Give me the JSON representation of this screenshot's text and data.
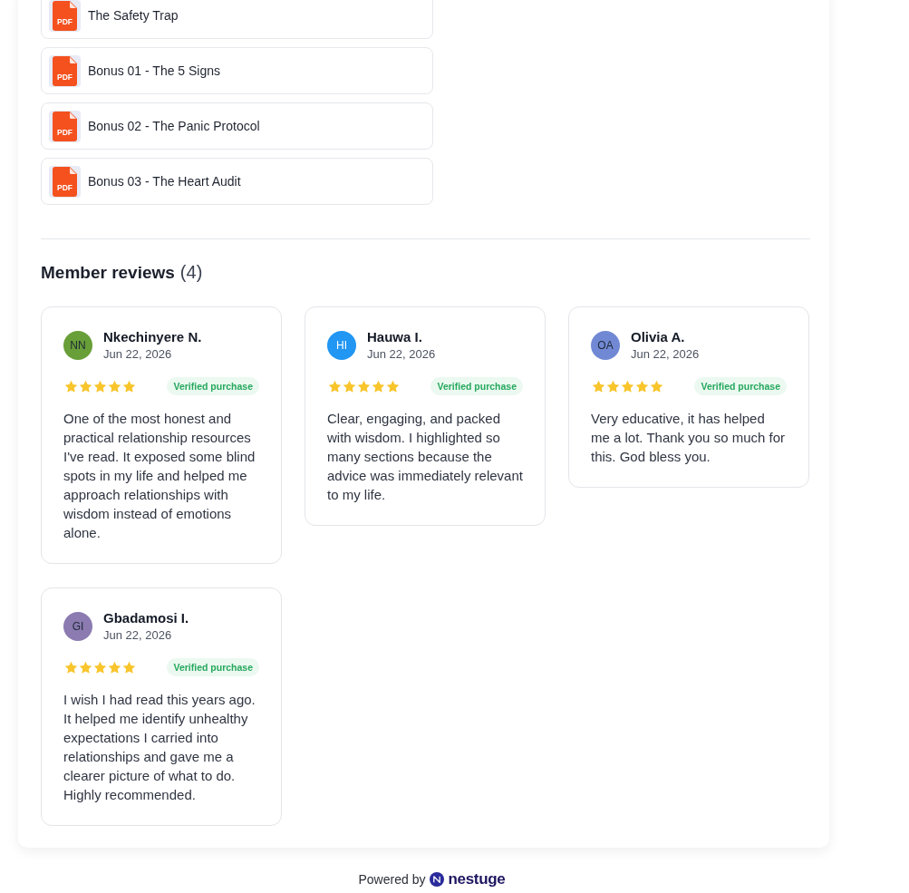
{
  "files": [
    {
      "title": "The Safety Trap",
      "file_type": "PDF"
    },
    {
      "title": "Bonus 01 - The 5 Signs",
      "file_type": "PDF"
    },
    {
      "title": "Bonus 02 - The Panic Protocol",
      "file_type": "PDF"
    },
    {
      "title": "Bonus 03 - The Heart Audit",
      "file_type": "PDF"
    }
  ],
  "reviews_section": {
    "title": "Member reviews",
    "count": "(4)"
  },
  "reviews": [
    {
      "avatar": {
        "initials": "NN",
        "color": "#689f38"
      },
      "name": "Nkechinyere N.",
      "date": "Jun 22, 2026",
      "stars": 5,
      "badge": "Verified purchase",
      "text": "One of the most honest and practical relationship resources I've read. It exposed some blind spots in my life and helped me approach relationships with wisdom instead of emotions alone."
    },
    {
      "avatar": {
        "initials": "HI",
        "color": "#2196f3"
      },
      "name": "Hauwa I.",
      "date": "Jun 22, 2026",
      "stars": 5,
      "badge": "Verified purchase",
      "text": "Clear, engaging, and packed with wisdom. I highlighted so many sections because the advice was immediately relevant to my life."
    },
    {
      "avatar": {
        "initials": "OA",
        "color": "#7189d4"
      },
      "name": "Olivia A.",
      "date": "Jun 22, 2026",
      "stars": 5,
      "badge": "Verified purchase",
      "text": "Very educative, it has helped me a lot. Thank you so much for this. God bless you."
    },
    {
      "avatar": {
        "initials": "GI",
        "color": "#8b7bb0"
      },
      "name": "Gbadamosi I.",
      "date": "Jun 22, 2026",
      "stars": 5,
      "badge": "Verified purchase",
      "text": "I wish I had read this years ago. It helped me identify unhealthy expectations I carried into relationships and gave me a clearer picture of what to do. Highly recommended."
    }
  ],
  "footer": {
    "label": "Powered by",
    "brand": "nestuge"
  }
}
